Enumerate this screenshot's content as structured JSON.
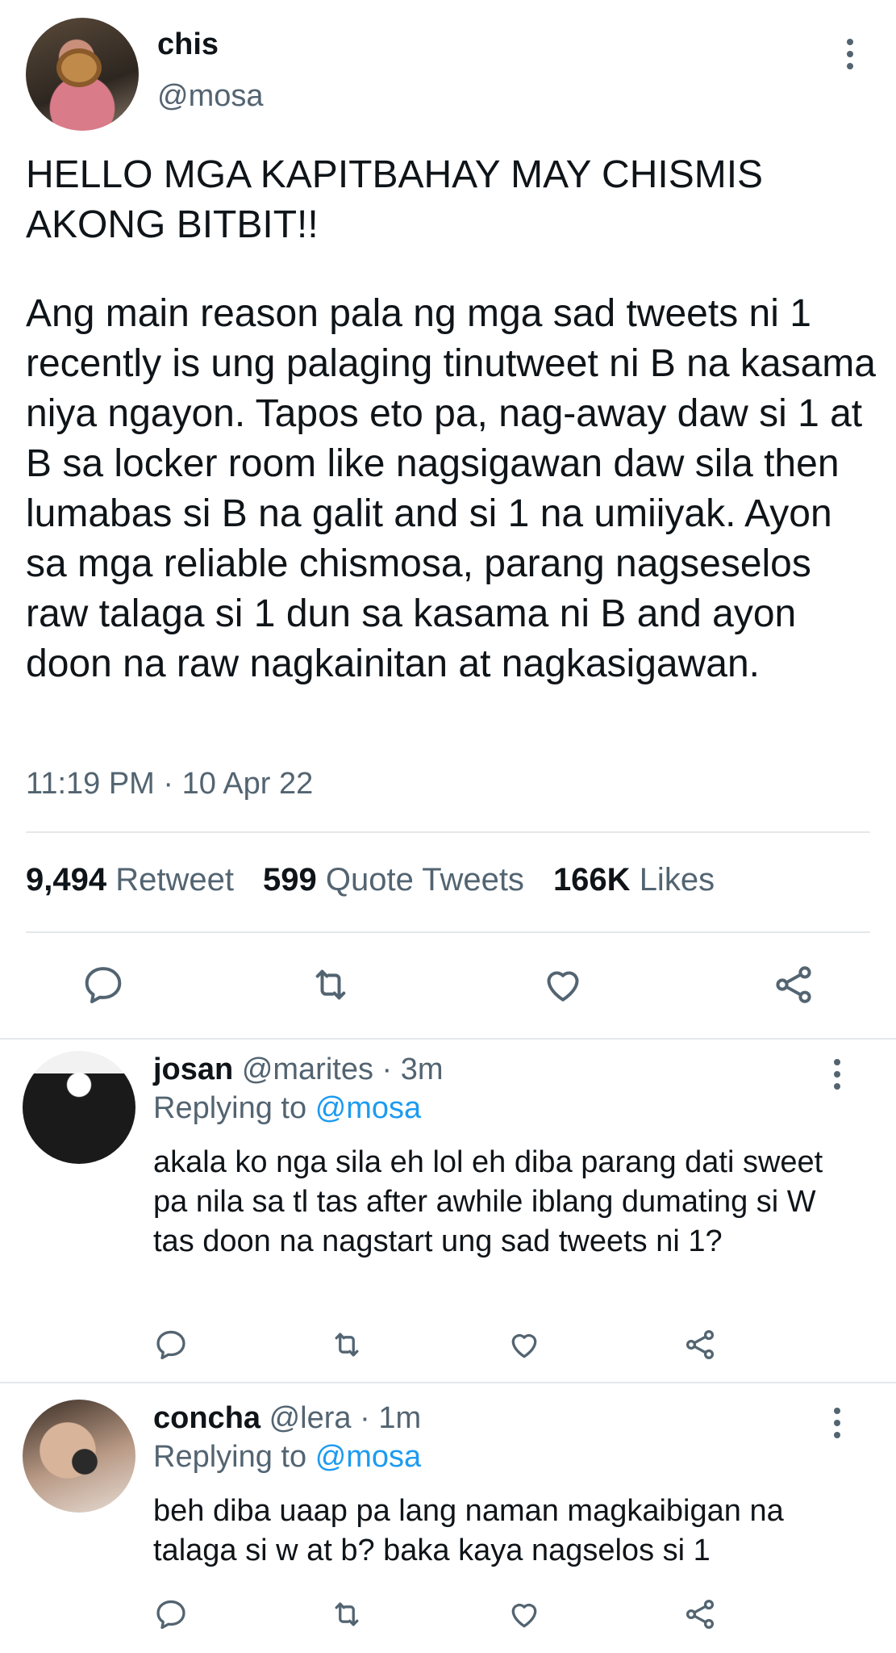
{
  "main_tweet": {
    "author_name": "chis",
    "author_handle": "@mosa",
    "headline": "HELLO MGA KAPITBAHAY MAY CHISMIS AKONG BITBIT!!",
    "body": "Ang main reason pala ng mga sad tweets ni 1 recently is ung palaging tinutweet ni B na kasama niya ngayon. Tapos eto pa, nag-away daw si 1 at B sa locker room like nagsigawan daw sila then lumabas si B na galit and si 1 na umiiyak. Ayon sa mga reliable chismosa, parang nagseselos raw talaga si 1 dun sa kasama ni B and ayon doon na raw nagkainitan at nagkasigawan.",
    "timestamp": "11:19 PM · 10 Apr 22",
    "stats": {
      "retweets_count": "9,494",
      "retweets_label": "Retweet",
      "quotes_count": "599",
      "quotes_label": "Quote Tweets",
      "likes_count": "166K",
      "likes_label": "Likes"
    }
  },
  "replies": [
    {
      "name": "josan",
      "meta": "@marites · 3m",
      "replying_prefix": "Replying to",
      "replying_to": "@mosa",
      "text": "akala ko nga sila eh lol eh diba parang dati sweet pa nila sa tl tas after awhile iblang dumating si W tas doon na nagstart ung sad tweets ni 1?"
    },
    {
      "name": "concha",
      "meta": "@lera · 1m",
      "replying_prefix": "Replying to",
      "replying_to": "@mosa",
      "text": "beh diba uaap pa lang naman magkaibigan na talaga si w at b? baka kaya nagselos si 1"
    }
  ],
  "icons": {
    "reply": "comment-bubble-icon",
    "retweet": "retweet-arrows-icon",
    "like": "heart-icon",
    "share": "share-nodes-icon",
    "more": "vertical-ellipsis-icon"
  },
  "colors": {
    "text": "#0f1419",
    "muted": "#536471",
    "link": "#1d9bf0",
    "divider": "#e4e8eb"
  }
}
